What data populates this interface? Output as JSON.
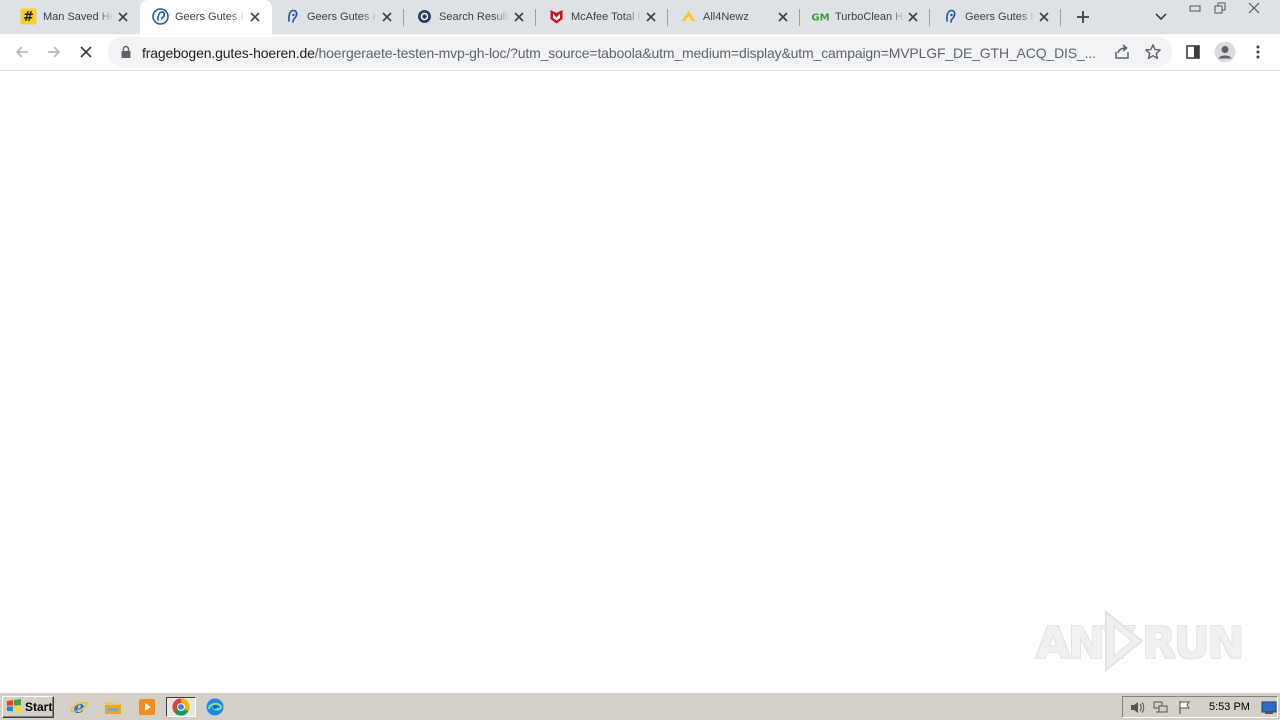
{
  "browser": {
    "tabs": [
      {
        "title": "Man Saved He",
        "icon": "hashtag-icon",
        "active": false
      },
      {
        "title": "Geers Gutes H",
        "icon": "ear-icon",
        "active": true
      },
      {
        "title": "Geers Gutes H",
        "icon": "ear-icon",
        "active": false
      },
      {
        "title": "Search Results",
        "icon": "search-results-icon",
        "active": false
      },
      {
        "title": "McAfee Total P",
        "icon": "mcafee-icon",
        "active": false
      },
      {
        "title": "All4Newz",
        "icon": "news-icon",
        "active": false
      },
      {
        "title": "TurboClean Ha",
        "icon": "gm-icon",
        "active": false
      },
      {
        "title": "Geers Gutes H",
        "icon": "ear-icon",
        "active": false
      }
    ],
    "address": {
      "host": "fragebogen.gutes-hoeren.de",
      "path": "/hoergeraete-testen-mvp-gh-loc/?utm_source=taboola&utm_medium=display&utm_campaign=MVPLGF_DE_GTH_ACQ_DIS_..."
    },
    "colors": {
      "tabstrip": "#dee1e6",
      "omnibox": "#f1f3f4"
    }
  },
  "watermark": {
    "left": "ANY",
    "right": "RUN"
  },
  "taskbar": {
    "start_label": "Start",
    "quick_launch": [
      "internet-explorer-icon",
      "file-explorer-icon",
      "media-player-icon",
      "chrome-icon",
      "edge-icon"
    ],
    "clock": "5:53 PM"
  }
}
